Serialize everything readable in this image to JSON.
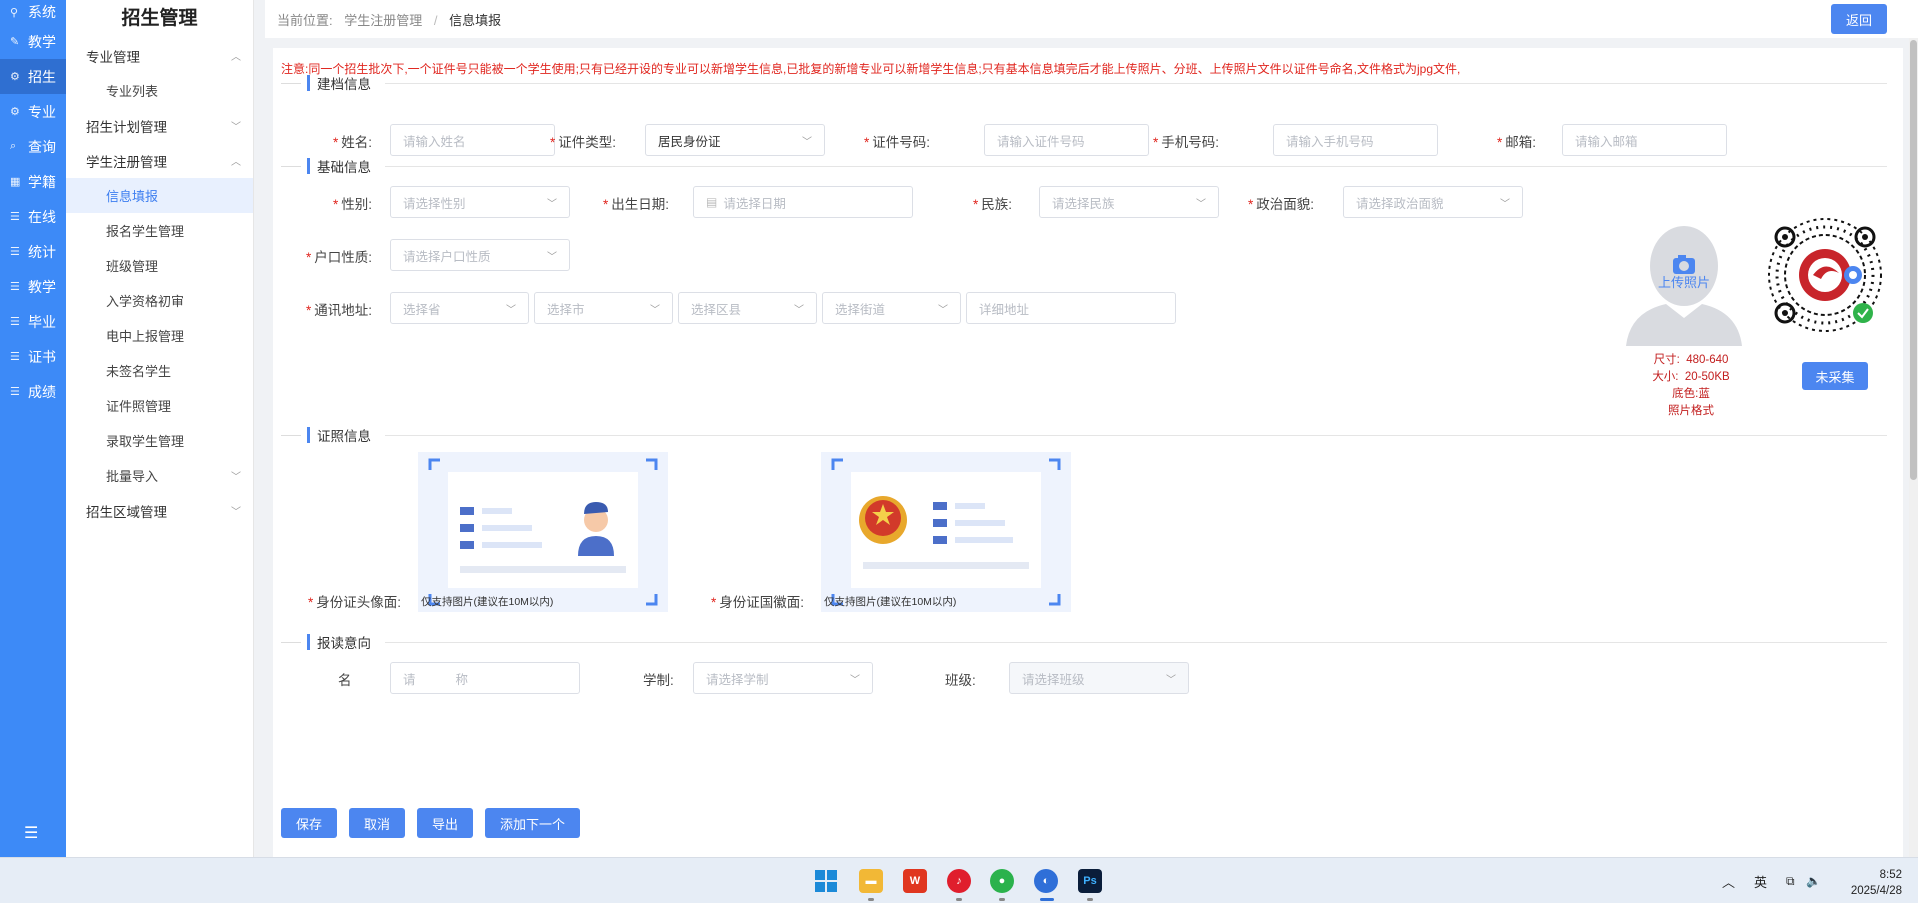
{
  "iconbar": {
    "items": [
      {
        "icon": "pin-icon",
        "glyph": "⚲",
        "label": "系统"
      },
      {
        "icon": "edit-icon",
        "glyph": "✎",
        "label": "教学"
      },
      {
        "icon": "gear-icon",
        "glyph": "⚙",
        "label": "招生"
      },
      {
        "icon": "gear-icon",
        "glyph": "⚙",
        "label": "专业"
      },
      {
        "icon": "search-icon",
        "glyph": "⌕",
        "label": "查询"
      },
      {
        "icon": "grid-icon",
        "glyph": "▦",
        "label": "学籍"
      },
      {
        "icon": "list-icon",
        "glyph": "☰",
        "label": "在线"
      },
      {
        "icon": "list-icon",
        "glyph": "☰",
        "label": "统计"
      },
      {
        "icon": "list-icon",
        "glyph": "☰",
        "label": "教学"
      },
      {
        "icon": "list-icon",
        "glyph": "☰",
        "label": "毕业"
      },
      {
        "icon": "list-icon",
        "glyph": "☰",
        "label": "证书"
      },
      {
        "icon": "list-icon",
        "glyph": "☰",
        "label": "成绩"
      }
    ],
    "active_index": 2,
    "menu_glyph": "☰"
  },
  "subnav": {
    "title": "招生管理",
    "groups": {
      "major": "专业管理",
      "major_list": "专业列表",
      "plan": "招生计划管理",
      "register": "学生注册管理",
      "info_fill": "信息填报",
      "apply_students": "报名学生管理",
      "class_manage": "班级管理",
      "qualification": "入学资格初审",
      "diandong": "电中上报管理",
      "unsigned": "未签名学生",
      "certificate_photo": "证件照管理",
      "admitted": "录取学生管理",
      "batch_import": "批量导入",
      "region": "招生区域管理"
    }
  },
  "breadcrumb": {
    "prefix": "当前位置:",
    "level1": "学生注册管理",
    "sep": "/",
    "level2": "信息填报"
  },
  "return_label": "返回",
  "notice": "注意:同一个招生批次下,一个证件号只能被一个学生使用;只有已经开设的专业可以新增学生信息,已批复的新增专业可以新增学生信息;只有基本信息填完后才能上传照片、分班、上传照片文件以证件号命名,文件格式为jpg文件,",
  "sections": {
    "filing": "建档信息",
    "basic": "基础信息",
    "certificate": "证照信息",
    "intent": "报读意向"
  },
  "filing": {
    "name_label": "姓名:",
    "name_ph": "请输入姓名",
    "idtype_label": "证件类型:",
    "idtype_value": "居民身份证",
    "idno_label": "证件号码:",
    "idno_ph": "请输入证件号码",
    "phone_label": "手机号码:",
    "phone_ph": "请输入手机号码",
    "email_label": "邮箱:",
    "email_ph": "请输入邮箱"
  },
  "basic": {
    "gender_label": "性别:",
    "gender_ph": "请选择性别",
    "birth_label": "出生日期:",
    "birth_ph": "请选择日期",
    "nation_label": "民族:",
    "nation_ph": "请选择民族",
    "politics_label": "政治面貌:",
    "politics_ph": "请选择政治面貌",
    "hukou_label": "户口性质:",
    "hukou_ph": "请选择户口性质",
    "address_label": "通讯地址:",
    "province_ph": "选择省",
    "city_ph": "选择市",
    "district_ph": "选择区县",
    "street_ph": "选择街道",
    "detail_ph": "详细地址"
  },
  "photo": {
    "upload_label": "上传照片",
    "size_label": "尺寸:",
    "size_value": "480-640",
    "filesize_label": "大小:",
    "filesize_value": "20-50KB",
    "bg_label": "底色:",
    "bg_value": "蓝",
    "format_label": "照片格式",
    "not_collected": "未采集"
  },
  "certificate": {
    "front_label": "身份证头像面:",
    "back_label": "身份证国徽面:",
    "note": "仅支持图片(建议在10M以内)"
  },
  "intent": {
    "major_label_partial": "名",
    "major_ph_partial": "请",
    "major_ph_partial2": "称",
    "system_label": "学制:",
    "system_ph": "请选择学制",
    "class_label": "班级:",
    "class_ph": "请选择班级"
  },
  "buttons": {
    "save": "保存",
    "cancel": "取消",
    "export": "导出",
    "add_next": "添加下一个"
  },
  "taskbar": {
    "ime": "英",
    "time": "8:52",
    "date": "2025/4/28",
    "ps_label": "Ps"
  },
  "colors": {
    "primary": "#3d8af7",
    "button": "#4c86f0",
    "required": "#e0261f",
    "spec_red": "#c21e1e"
  }
}
